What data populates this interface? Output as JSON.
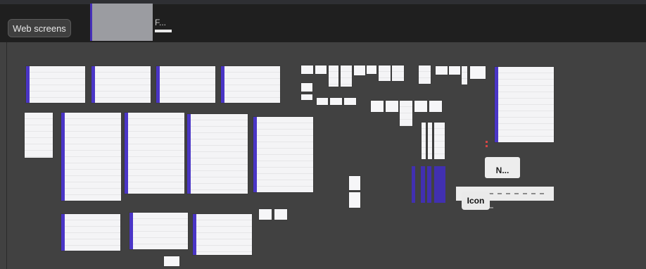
{
  "toolbar": {
    "page_label": "Web screens",
    "frame_label": "F..."
  },
  "canvas": {
    "labels": {
      "n_label": "N...",
      "icon_label": "Icon"
    }
  },
  "colors": {
    "canvas_bg": "#414141",
    "topbar_bg": "#1f1f1f",
    "accent": "#4a35c6"
  }
}
